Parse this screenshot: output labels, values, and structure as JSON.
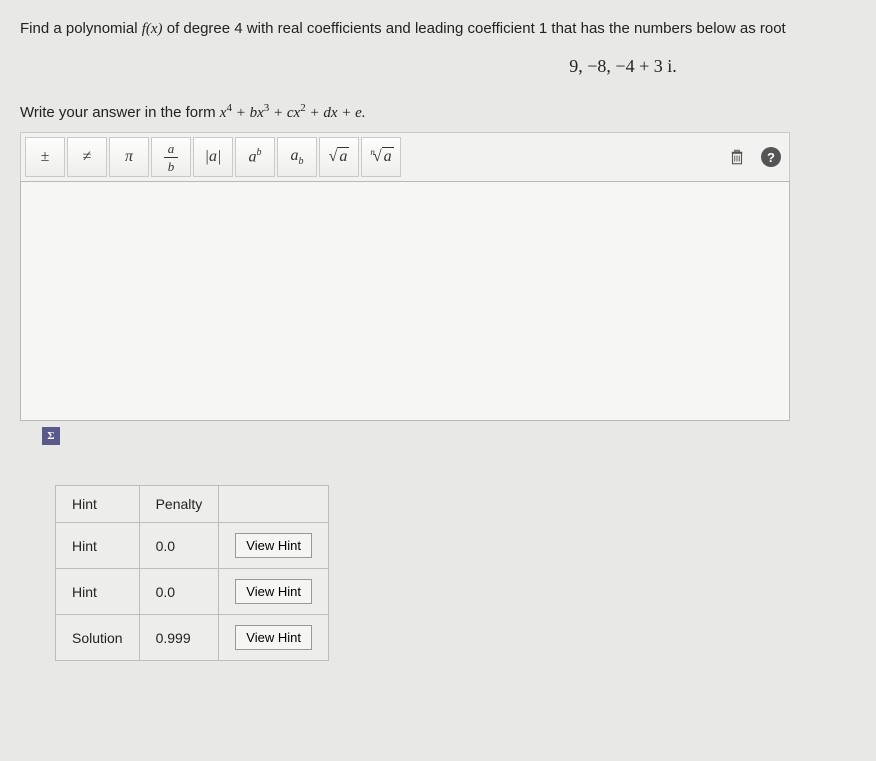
{
  "question": {
    "prompt_prefix": "Find a polynomial ",
    "prompt_fx": "f(x)",
    "prompt_suffix": " of degree 4 with real coefficients and leading coefficient 1 that has the numbers below as root",
    "roots": "9, −8, −4 + 3 i.",
    "instruction_prefix": "Write your answer in the form ",
    "poly_form": "x⁴ + bx³ + cx² + dx + e."
  },
  "toolbar": {
    "plusminus": "±",
    "neq": "≠",
    "pi": "π",
    "frac_a": "a",
    "frac_b": "b",
    "abs": "|a|",
    "sup_base": "a",
    "sup_exp": "b",
    "sub_base": "a",
    "sub_sub": "b",
    "sqrt_a": "a",
    "nroot_n": "n",
    "nroot_a": "a",
    "help": "?"
  },
  "hints": {
    "header_hint": "Hint",
    "header_penalty": "Penalty",
    "rows": [
      {
        "label": "Hint",
        "penalty": "0.0",
        "button": "View Hint"
      },
      {
        "label": "Hint",
        "penalty": "0.0",
        "button": "View Hint"
      },
      {
        "label": "Solution",
        "penalty": "0.999",
        "button": "View Hint"
      }
    ]
  }
}
